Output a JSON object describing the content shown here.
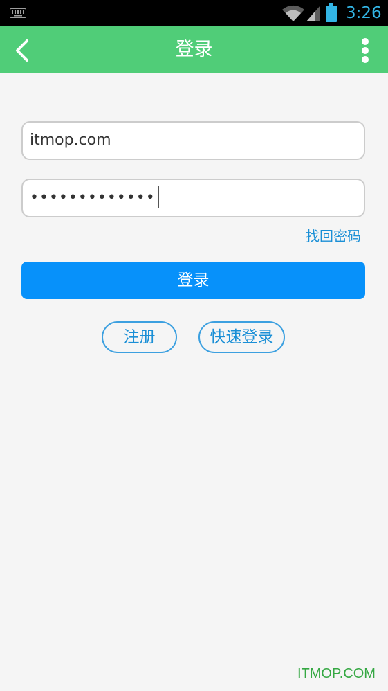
{
  "status_bar": {
    "time": "3:26",
    "icons": [
      "keyboard-icon",
      "wifi-icon",
      "signal-icon",
      "battery-icon"
    ]
  },
  "app_bar": {
    "title": "登录",
    "back_icon": "chevron-left-icon",
    "menu_icon": "more-vertical-icon",
    "color": "#50cd78"
  },
  "form": {
    "username_value": "itmop.com",
    "password_masked": "•••••••••••••",
    "forgot_password_label": "找回密码",
    "login_button_label": "登录",
    "register_label": "注册",
    "quick_login_label": "快速登录"
  },
  "watermark": "ITMOP.COM",
  "colors": {
    "primary_blue": "#0791fa",
    "link_blue": "#1a8fd6",
    "status_blue": "#33b5e5",
    "background": "#f5f5f5"
  }
}
